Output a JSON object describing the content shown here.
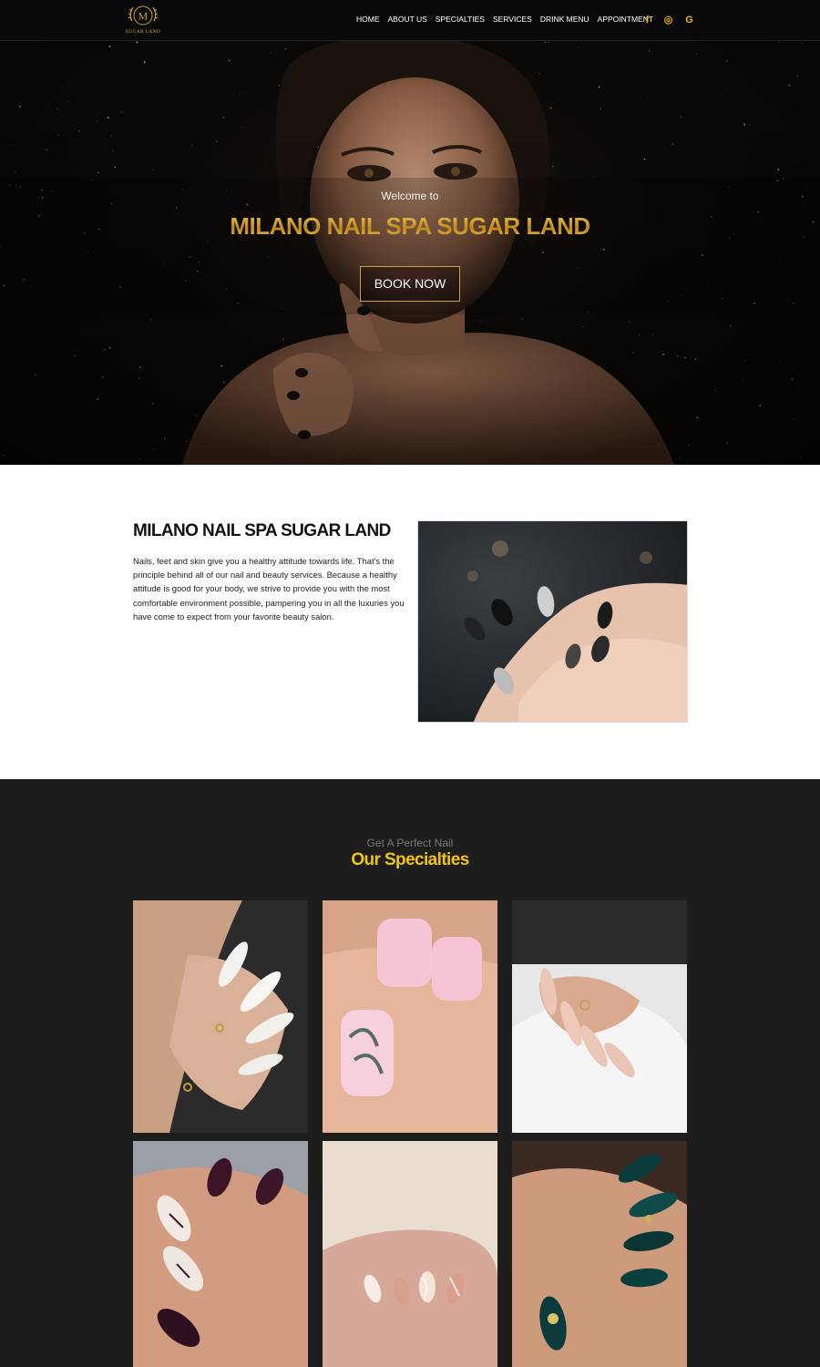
{
  "header": {
    "logo_letter": "M",
    "logo_text": "SUGAR LAND",
    "nav": [
      "HOME",
      "ABOUT US",
      "SPECIALTIES",
      "SERVICES",
      "DRINK MENU",
      "APPOINTMENT"
    ],
    "social_icons": [
      "facebook-icon",
      "instagram-icon",
      "google-icon"
    ],
    "social_glyphs": [
      "f",
      "◎",
      "G"
    ]
  },
  "hero": {
    "welcome": "Welcome to",
    "title": "MILANO NAIL SPA SUGAR LAND",
    "button": "BOOK NOW"
  },
  "about": {
    "title": "MILANO NAIL SPA SUGAR LAND",
    "text": "Nails, feet and skin give you a healthy attitude towards life. That's the principle behind all of our nail and beauty services. Because a healthy attitude is good for your body, we strive to provide you with the most comfortable environment possible, pampering you in all the luxuries you have come to expect from your favorite beauty salon."
  },
  "specialties": {
    "subtitle": "Get A Perfect Nail",
    "title": "Our Specialties"
  },
  "colors": {
    "gold": "#d4a72c",
    "accent_yellow": "#f1c40f",
    "dark_bg": "#1d1d1d",
    "header_bg": "#0a0a0a"
  }
}
